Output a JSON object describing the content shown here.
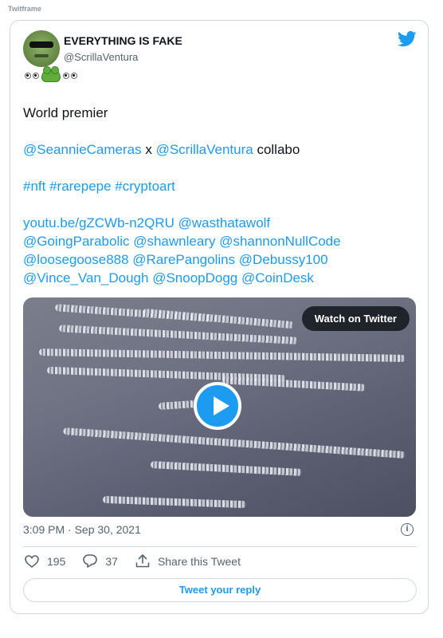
{
  "frame_label": "Twitframe",
  "author": {
    "display_name": "EVERYTHING IS FAKE",
    "handle": "@ScrillaVentura"
  },
  "tweet": {
    "line1": "World premier",
    "mention1": "@SeannieCameras",
    "x_sep": " x ",
    "mention2": "@ScrillaVentura",
    "collab_word": " collabo",
    "hashtags": "#nft #rarepepe #cryptoart",
    "link_lines": [
      "youtu.be/gZCWb-n2QRU @wasthatawolf",
      "@GoingParabolic @shawnleary @shannonNullCode",
      "@loosegoose888 @RarePangolins @Debussy100",
      "@Vince_Van_Dough @SnoopDogg @CoinDesk"
    ]
  },
  "media": {
    "watch_label": "Watch on Twitter"
  },
  "timestamp": "3:09 PM · Sep 30, 2021",
  "actions": {
    "likes": "195",
    "replies": "37",
    "share_label": "Share this Tweet"
  },
  "reply_button": "Tweet your reply",
  "colors": {
    "link": "#1d9bf0",
    "text": "#0f1419",
    "muted": "#536471",
    "border": "#cfd9de"
  },
  "icons": [
    "twitter-bird-icon",
    "play-icon",
    "info-icon",
    "heart-icon",
    "reply-icon",
    "share-icon"
  ]
}
